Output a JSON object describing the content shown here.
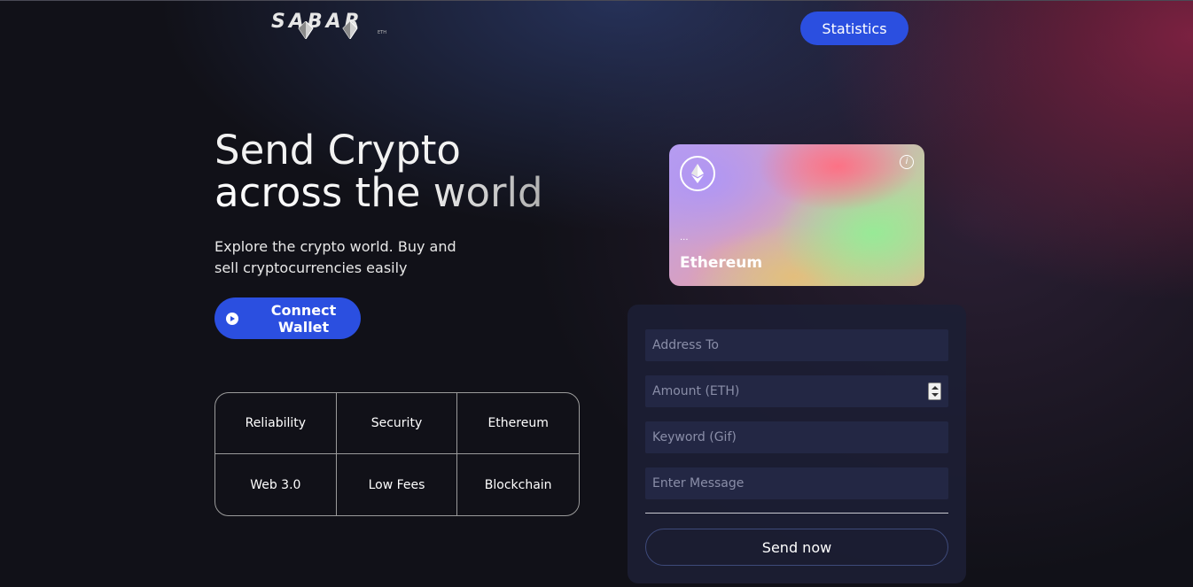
{
  "header": {
    "logo_text": "SABAR",
    "logo_sub": "ETH",
    "nav_button": "Statistics"
  },
  "hero": {
    "title_line1": "Send Crypto",
    "title_line2": "across the world",
    "subtitle": "Explore the crypto world. Buy and sell cryptocurrencies easily",
    "connect_button": "Connect Wallet",
    "connect_icon": "play-circle-icon"
  },
  "features": [
    "Reliability",
    "Security",
    "Ethereum",
    "Web 3.0",
    "Low Fees",
    "Blockchain"
  ],
  "card": {
    "icon": "ethereum-icon",
    "info_icon": "info-icon",
    "address": "...",
    "network": "Ethereum"
  },
  "form": {
    "address_placeholder": "Address To",
    "amount_placeholder": "Amount (ETH)",
    "keyword_placeholder": "Keyword (Gif)",
    "message_placeholder": "Enter Message",
    "submit_label": "Send now"
  },
  "colors": {
    "accent": "#2b4fe0",
    "background": "#111118",
    "panel": "#1c1e34",
    "field": "#232744"
  }
}
